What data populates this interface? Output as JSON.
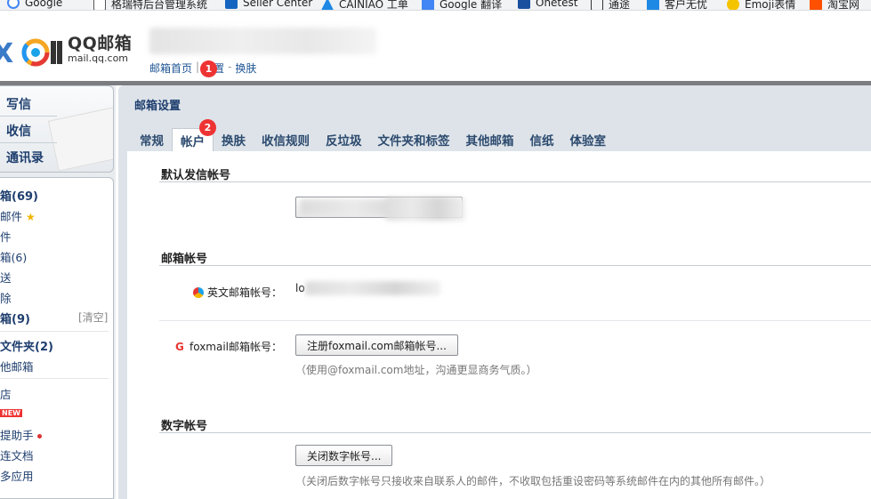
{
  "bookmarks": [
    {
      "label": "Google",
      "color": "#4285f4"
    },
    {
      "label": "格瑞特后台管理系统",
      "color": "#555555"
    },
    {
      "label": "Seller Center",
      "color": "#1565c0"
    },
    {
      "label": "CAINIAO 工单",
      "color": "#1e88e5"
    },
    {
      "label": "Google 翻译",
      "color": "#4285f4"
    },
    {
      "label": "Onetest",
      "color": "#1a4fa0"
    },
    {
      "label": "通途",
      "color": "#333333"
    },
    {
      "label": "客户无忧",
      "color": "#1e88e5"
    },
    {
      "label": "Emoji表情",
      "color": "#f5c400"
    },
    {
      "label": "淘宝网",
      "color": "#ff5000"
    }
  ],
  "logo": {
    "title": "QQ邮箱",
    "subtitle": "mail.qq.com"
  },
  "toplinks": {
    "home": "邮箱首页",
    "sep": "|",
    "settings": "设置",
    "dash": "-",
    "skin": "换肤"
  },
  "badges": {
    "one": "1",
    "two": "2"
  },
  "compose": {
    "write": "写信",
    "inbox": "收信",
    "contacts": "通讯录"
  },
  "folders": {
    "inbox": "箱(69)",
    "starred": "邮件",
    "group": "件",
    "drafts": "箱(6)",
    "sent": "送",
    "deleted": "除",
    "spam": "箱(9)",
    "clear": "[清空]",
    "myfolders": "文件夹(2)",
    "other": "他邮箱",
    "app1": "店",
    "app2": "",
    "new_tag": "NEW",
    "app3": "提助手",
    "app4": "连文档",
    "app5": "多应用"
  },
  "main": {
    "title": "邮箱设置",
    "tabs": [
      "常规",
      "帐户",
      "换肤",
      "收信规则",
      "反垃圾",
      "文件夹和标签",
      "其他邮箱",
      "信纸",
      "体验室"
    ],
    "active_tab": "帐户"
  },
  "sections": {
    "default_sender": {
      "title": "默认发信帐号"
    },
    "mail_accounts": {
      "title": "邮箱帐号",
      "english_label": "英文邮箱帐号：",
      "english_value": "lo",
      "foxmail_label": "foxmail邮箱帐号：",
      "foxmail_button": "注册foxmail.com邮箱帐号...",
      "foxmail_hint": "（使用@foxmail.com地址，沟通更显商务气质。）"
    },
    "digital": {
      "title": "数字帐号",
      "button": "关闭数字帐号...",
      "hint": "（关闭后数字帐号只接收来自联系人的邮件，不收取包括重设密码等系统邮件在内的其他所有邮件。）"
    }
  }
}
